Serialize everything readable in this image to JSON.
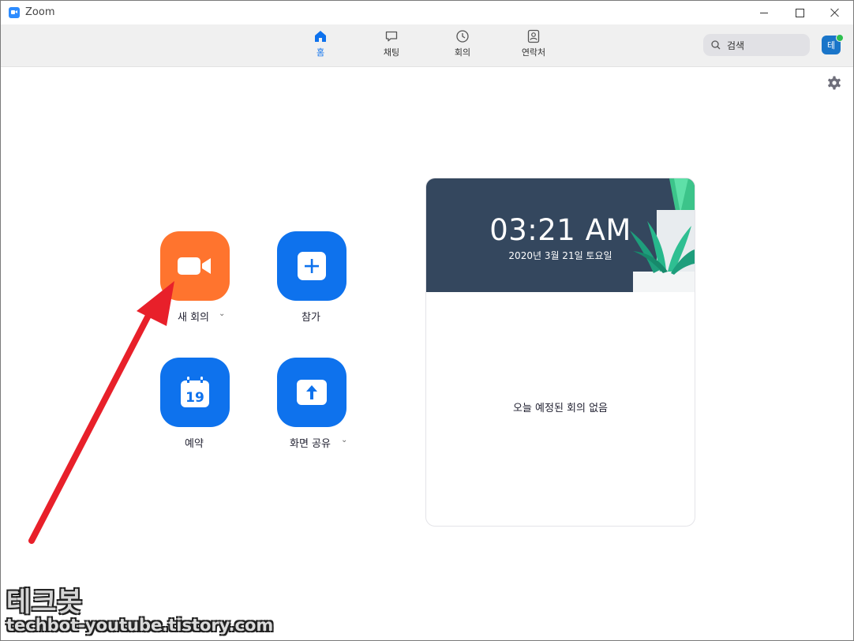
{
  "window": {
    "title": "Zoom"
  },
  "nav": {
    "tabs": [
      {
        "label": "홈",
        "icon": "home-icon",
        "active": true
      },
      {
        "label": "채팅",
        "icon": "chat-icon",
        "active": false
      },
      {
        "label": "회의",
        "icon": "clock-icon",
        "active": false
      },
      {
        "label": "연락처",
        "icon": "contacts-icon",
        "active": false
      }
    ],
    "search_placeholder": "검색",
    "avatar_initial": "테"
  },
  "actions": {
    "new_meeting": {
      "label": "새 회의",
      "icon": "video-camera-icon"
    },
    "join": {
      "label": "참가",
      "icon": "plus-icon"
    },
    "schedule": {
      "label": "예약",
      "icon": "calendar-icon",
      "calendar_day": "19"
    },
    "share_screen": {
      "label": "화면 공유",
      "icon": "upload-arrow-icon"
    },
    "caret": "⌄"
  },
  "card": {
    "time": "03:21 AM",
    "date": "2020년 3월 21일 토요일",
    "empty_message": "오늘 예정된 회의 없음"
  },
  "watermark": {
    "title": "테크봇",
    "url": "techbot-youtube.tistory.com"
  },
  "colors": {
    "accent_blue": "#0e72ed",
    "new_meeting_orange": "#ff742e",
    "banner_bg": "#34475e",
    "annotation_arrow": "#e8202a"
  }
}
